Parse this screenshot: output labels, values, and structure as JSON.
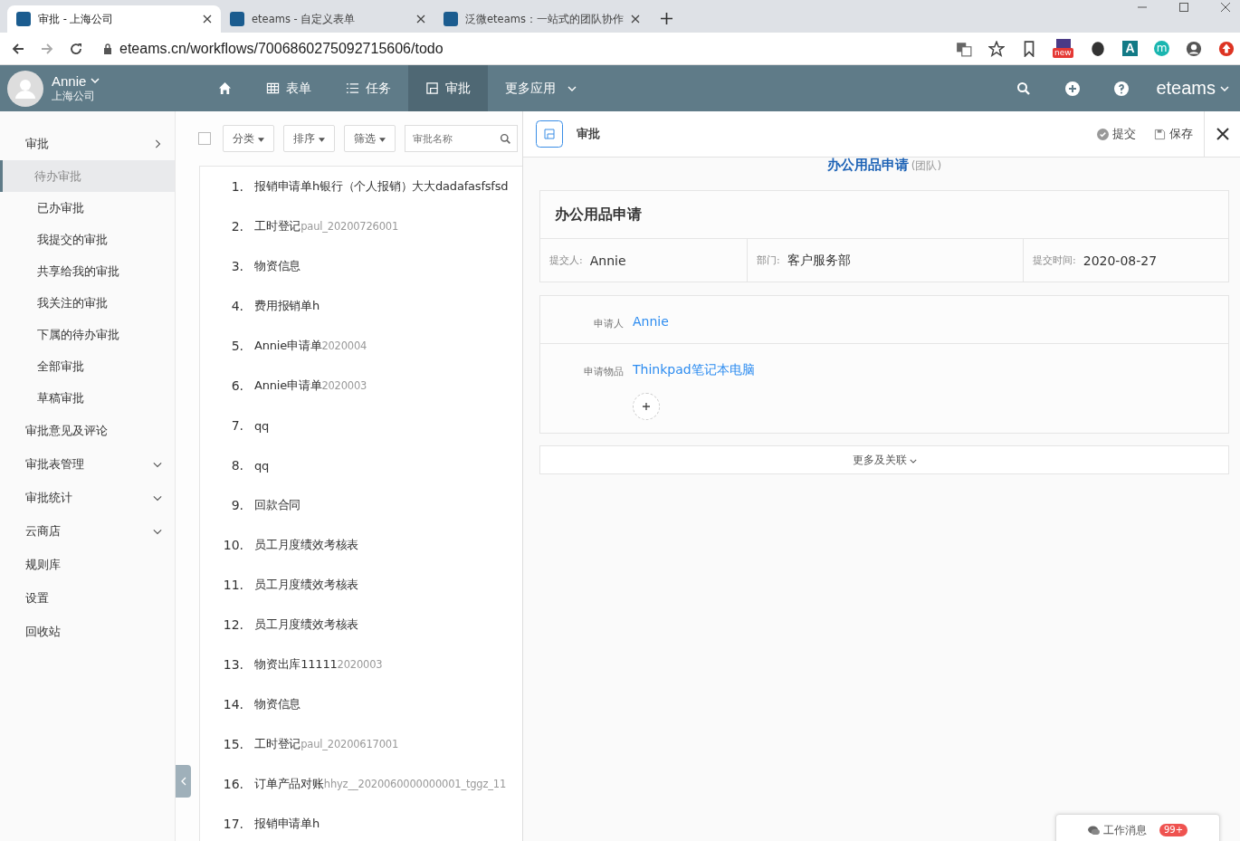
{
  "browser": {
    "tabs": [
      {
        "title": "审批 - 上海公司",
        "selected": true
      },
      {
        "title": "eteams - 自定义表单",
        "selected": false
      },
      {
        "title": "泛微eteams：一站式的团队协作",
        "selected": false
      }
    ],
    "url": "eteams.cn/workflows/7006860275092715606/todo",
    "extension_badge": "new",
    "extension_letters": [
      "A",
      "m"
    ]
  },
  "header": {
    "user": {
      "name": "Annie",
      "company": "上海公司"
    },
    "nav": [
      {
        "kind": "home",
        "selected": false
      },
      {
        "kind": "grid",
        "label": "表单",
        "selected": false
      },
      {
        "kind": "list",
        "label": "任务",
        "selected": false
      },
      {
        "kind": "approval",
        "label": "审批",
        "selected": true
      },
      {
        "kind": "more",
        "label": "更多应用",
        "selected": false
      }
    ],
    "logo": "eteams"
  },
  "sidebar": {
    "items": [
      {
        "label": "审批",
        "expanded": true,
        "children": [
          {
            "label": "待办审批",
            "selected": true
          },
          {
            "label": "已办审批",
            "selected": false
          },
          {
            "label": "我提交的审批",
            "selected": false
          },
          {
            "label": "共享给我的审批",
            "selected": false
          },
          {
            "label": "我关注的审批",
            "selected": false
          },
          {
            "label": "下属的待办审批",
            "selected": false
          },
          {
            "label": "全部审批",
            "selected": false
          },
          {
            "label": "草稿审批",
            "selected": false
          }
        ]
      },
      {
        "label": "审批意见及评论"
      },
      {
        "label": "审批表管理",
        "expanded": false
      },
      {
        "label": "审批统计",
        "expanded": false
      },
      {
        "label": "云商店",
        "expanded": false
      },
      {
        "label": "规则库"
      },
      {
        "label": "设置"
      },
      {
        "label": "回收站"
      }
    ]
  },
  "toolbar": {
    "select_all": {
      "checked": false
    },
    "filters": [
      "分类",
      "排序",
      "筛选"
    ],
    "search": {
      "placeholder": "审批名称"
    }
  },
  "list": [
    {
      "number": "1.",
      "title": "报销申请单h银行（个人报销）大大dadafasfsfsd"
    },
    {
      "number": "2.",
      "title": "工时登记",
      "code": "paul_20200726001"
    },
    {
      "number": "3.",
      "title": "物资信息"
    },
    {
      "number": "4.",
      "title": "费用报销单h"
    },
    {
      "number": "5.",
      "title": "Annie申请单",
      "code": "2020004"
    },
    {
      "number": "6.",
      "title": "Annie申请单",
      "code": "2020003"
    },
    {
      "number": "7.",
      "title": "qq"
    },
    {
      "number": "8.",
      "title": "qq"
    },
    {
      "number": "9.",
      "title": "回款合同"
    },
    {
      "number": "10.",
      "title": "员工月度绩效考核表"
    },
    {
      "number": "11.",
      "title": "员工月度绩效考核表"
    },
    {
      "number": "12.",
      "title": "员工月度绩效考核表"
    },
    {
      "number": "13.",
      "title": "物资出库11111",
      "code": "2020003"
    },
    {
      "number": "14.",
      "title": "物资信息"
    },
    {
      "number": "15.",
      "title": "工时登记",
      "code": "paul_20200617001"
    },
    {
      "number": "16.",
      "title": "订单产品对账",
      "code": "hhyz__2020060000000001_tggz_11"
    },
    {
      "number": "17.",
      "title": "报销申请单h"
    }
  ],
  "detail": {
    "title": "审批",
    "actions": [
      "提交",
      "保存"
    ],
    "form_name": "办公用品申请",
    "form_scope": "(团队)",
    "card_title": "办公用品申请",
    "meta": [
      {
        "label": "提交人:",
        "value": "Annie"
      },
      {
        "label": "部门:",
        "value": "客户服务部"
      },
      {
        "label": "提交时间:",
        "value": "2020-08-27"
      }
    ],
    "fields": [
      {
        "label": "申请人",
        "value": "Annie"
      },
      {
        "label": "申请物品",
        "value": "Thinkpad笔记本电脑"
      }
    ],
    "more": "更多及关联"
  },
  "messages": {
    "label": "工作消息",
    "count": "99+"
  }
}
